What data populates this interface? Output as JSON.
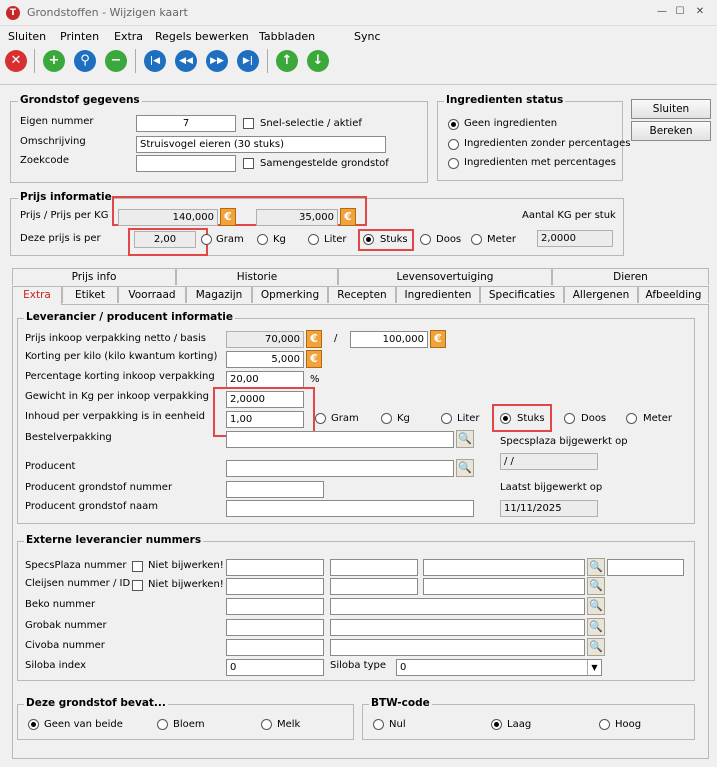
{
  "window": {
    "title": "Grondstoffen - Wijzigen kaart",
    "minimize": "—",
    "maximize": "☐",
    "close": "✕"
  },
  "menu": [
    "Sluiten",
    "Printen",
    "Extra",
    "Regels bewerken",
    "Tabbladen",
    "Sync"
  ],
  "toolbar": {
    "icons": [
      "close-red",
      "add-green",
      "search-blue",
      "remove-green",
      "first",
      "prev",
      "next",
      "last",
      "up",
      "down"
    ],
    "colors": {
      "red": "#d83030",
      "green": "#3aa83a",
      "blue": "#1f6fc0"
    }
  },
  "grondstof": {
    "legend": "Grondstof gegevens",
    "eigen_nummer_label": "Eigen nummer",
    "eigen_nummer": "7",
    "snel_label": "Snel-selectie  / aktief",
    "omschrijving_label": "Omschrijving",
    "omschrijving": "Struisvogel eieren (30 stuks)",
    "zoekcode_label": "Zoekcode",
    "zoekcode": "",
    "samengesteld_label": "Samengestelde grondstof"
  },
  "ingredienten": {
    "legend": "Ingredienten status",
    "options": [
      "Geen ingredienten",
      "Ingredienten zonder percentages",
      "Ingredienten met percentages"
    ],
    "selected": 0
  },
  "buttons": {
    "sluiten": "Sluiten",
    "bereken": "Bereken"
  },
  "prijs": {
    "legend": "Prijs informatie",
    "prijs_label": "Prijs / Prijs per KG",
    "prijs": "140,000",
    "prijs_kg": "35,000",
    "aantal_label": "Aantal KG per stuk",
    "per_label": "Deze prijs is per",
    "per_value": "2,00",
    "units": [
      "Gram",
      "Kg",
      "Liter",
      "Stuks",
      "Doos",
      "Meter"
    ],
    "unit_selected": 3,
    "aantal_value": "2,0000"
  },
  "tabs": {
    "row1": [
      "Prijs info",
      "Historie",
      "Levensovertuiging",
      "Dieren"
    ],
    "row2": [
      "Extra",
      "Etiket",
      "Voorraad",
      "Magazijn",
      "Opmerking",
      "Recepten",
      "Ingredienten",
      "Specificaties",
      "Allergenen",
      "Afbeelding"
    ],
    "active": "Extra"
  },
  "leverancier": {
    "legend": "Leverancier / producent informatie",
    "inkoop_label": "Prijs inkoop verpakking  netto / basis",
    "inkoop_netto": "70,000",
    "inkoop_sep": "/",
    "inkoop_basis": "100,000",
    "korting_kilo_label": "Korting per kilo (kilo kwantum korting)",
    "korting_kilo": "5,000",
    "pct_label": "Percentage korting inkoop verpakking",
    "pct": "20,00",
    "pct_unit": "%",
    "gewicht_label": "Gewicht in Kg per inkoop verpakking",
    "gewicht": "2,0000",
    "inhoud_label": "Inhoud per verpakking is in eenheid",
    "inhoud": "1,00",
    "units": [
      "Gram",
      "Kg",
      "Liter",
      "Stuks",
      "Doos",
      "Meter"
    ],
    "unit_selected": 3,
    "bestel_label": "Bestelverpakking",
    "specs_label": "Specsplaza bijgewerkt op",
    "specs_value": "/ /",
    "producent_label": "Producent",
    "prod_nr_label": "Producent grondstof nummer",
    "laatst_label": "Laatst bijgewerkt op",
    "prod_naam_label": "Producent grondstof naam",
    "laatst_value": "11/11/2025"
  },
  "extern": {
    "legend": "Externe leverancier nummers",
    "specs_label": "SpecsPlaza nummer",
    "cleijsen_label": "Cleijsen nummer / ID",
    "niet_label": "Niet bijwerken!",
    "beko_label": "Beko nummer",
    "grobak_label": "Grobak nummer",
    "civoba_label": "Civoba nummer",
    "siloba_index_label": "Siloba index",
    "siloba_index": "0",
    "siloba_type_label": "Siloba type",
    "siloba_type": "0"
  },
  "bevat": {
    "legend": "Deze grondstof bevat...",
    "options": [
      "Geen van beide",
      "Bloem",
      "Melk"
    ],
    "selected": 0
  },
  "btw": {
    "legend": "BTW-code",
    "options": [
      "Nul",
      "Laag",
      "Hoog"
    ],
    "selected": 1
  }
}
